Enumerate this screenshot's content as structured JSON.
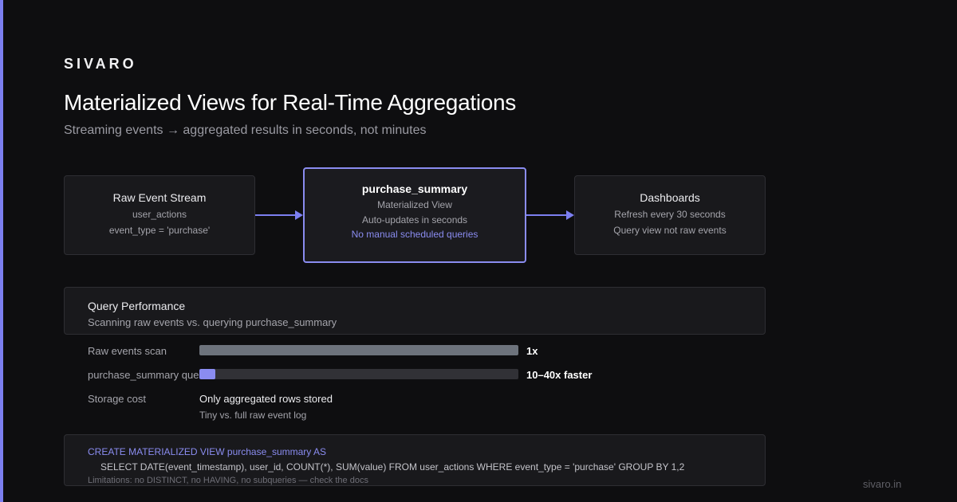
{
  "brand": "SIVARO",
  "title": "Materialized Views for Real-Time Aggregations",
  "subtitle": "Streaming events → aggregated results in seconds, not minutes",
  "flow": {
    "source": {
      "name": "Raw Event Stream",
      "lines": [
        "user_actions",
        "event_type = 'purchase'"
      ]
    },
    "view": {
      "name": "purchase_summary",
      "lines": [
        "Materialized View",
        "Auto-updates in seconds"
      ],
      "highlight": "No manual scheduled queries"
    },
    "target": {
      "name": "Dashboards",
      "lines": [
        "Refresh every 30 seconds",
        "Query view not raw events"
      ]
    }
  },
  "performance": {
    "title": "Query Performance",
    "subtitle": "Scanning raw events vs. querying purchase_summary",
    "rows": [
      {
        "label": "Raw events scan",
        "value_text": "1x",
        "fill_fraction": 1.0
      },
      {
        "label": "purchase_summary query",
        "value_text": "10–40x faster",
        "fill_fraction": 0.05
      }
    ],
    "storage": {
      "label": "Storage cost",
      "value": "Only aggregated rows stored",
      "note": "Tiny vs. full raw event log"
    }
  },
  "code": {
    "line1": "CREATE MATERIALIZED VIEW purchase_summary AS",
    "line2": "SELECT DATE(event_timestamp), user_id, COUNT(*), SUM(value) FROM user_actions WHERE event_type = 'purchase' GROUP BY 1,2",
    "note": "Limitations: no DISTINCT, no HAVING, no subqueries — check the docs"
  },
  "site": "sivaro.in",
  "colors": {
    "accent": "#7c7ff0",
    "background": "#0e0e10",
    "panel": "#19191c",
    "raw_bar": "#6d737c"
  }
}
